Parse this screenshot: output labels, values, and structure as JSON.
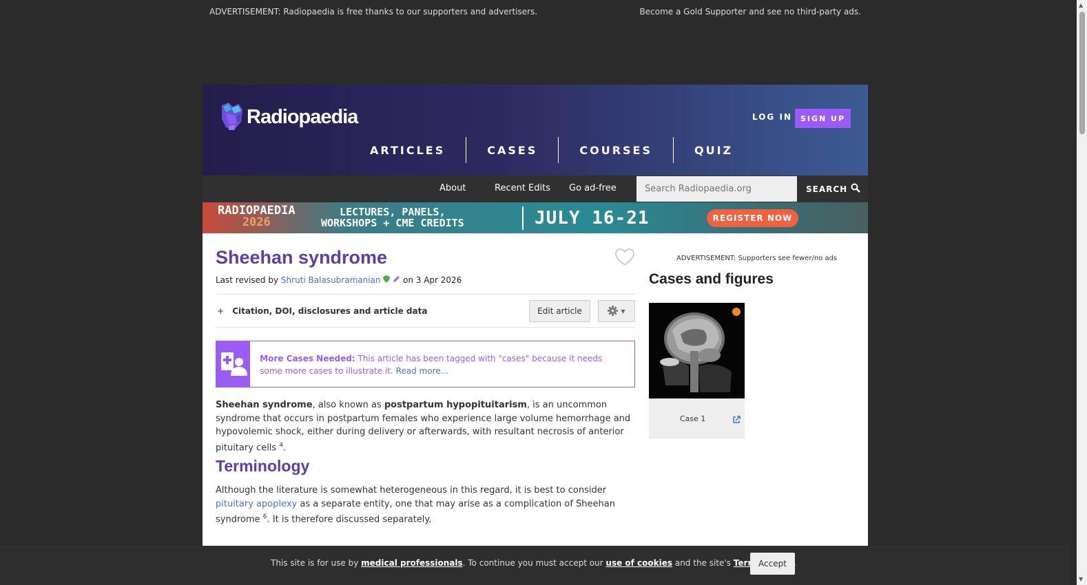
{
  "ad_bar": {
    "left_text": "ADVERTISEMENT: Radiopaedia is free thanks to our supporters and advertisers.",
    "right_text": "Become a Gold Supporter and see no third-party ads."
  },
  "header": {
    "logo_text": "Radiopaedia",
    "login_label": "LOG IN",
    "signup_label": "SIGN UP",
    "nav": [
      "ARTICLES",
      "CASES",
      "COURSES",
      "QUIZ"
    ]
  },
  "subnav": {
    "links": [
      "About",
      "Recent Edits",
      "Go ad-free"
    ],
    "search_placeholder": "Search Radiopaedia.org",
    "search_label": "SEARCH"
  },
  "banner": {
    "line1": "RADIOPAEDIA",
    "line2": "2026",
    "tag1": "LECTURES, PANELS,",
    "tag2": "WORKSHOPS + CME CREDITS",
    "dates": "JULY 16-21",
    "cta": "REGISTER NOW"
  },
  "article": {
    "title": "Sheehan syndrome",
    "revised_prefix": "Last revised by",
    "author": "Shruti Balasubramanian",
    "revised_date": "on 3 Apr 2026",
    "citation_label": "Citation, DOI, disclosures and article data",
    "citation_toggle": "+",
    "edit_label": "Edit article",
    "notice": {
      "heading": "More Cases Needed:",
      "body": "This article has been tagged with \"cases\" because it needs some more cases to illustrate it.",
      "link": "Read more..."
    },
    "intro": {
      "term1": "Sheehan syndrome",
      "part1": ", also known as ",
      "term2": "postpartum hypopituitarism",
      "part2": ", is an uncommon syndrome that occurs in postpartum females who experience large volume hemorrhage and hypovolemic shock, either during delivery or afterwards, with resultant necrosis of anterior pituitary cells ",
      "ref": "4",
      "end": "."
    },
    "section_heading": "Terminology",
    "terminology": {
      "part1": "Although the literature is somewhat heterogeneous in this regard, it is best to consider ",
      "link": "pituitary apoplexy",
      "part2": " as a separate entity, one that may arise as a complication of Sheehan syndrome ",
      "ref": "6",
      "part3": ". It is therefore discussed separately."
    }
  },
  "sidebar": {
    "ad_note": "ADVERTISEMENT: Supporters see fewer/no ads",
    "title": "Cases and figures",
    "case_label": "Case 1"
  },
  "cookie": {
    "text1": "This site is for use by ",
    "link1": "medical professionals",
    "text2": ". To continue you must accept our ",
    "link2": "use of cookies",
    "text3": " and the site's ",
    "link3": "Terms of Use",
    "text4": ".",
    "accept_label": "Accept"
  },
  "colors": {
    "brand_purple": "#5e3ea6",
    "accent_violet": "#9b5cf5",
    "link_blue": "#4a72c0",
    "status_orange": "#f08a24"
  },
  "icons": [
    "logo-mark-icon",
    "heart-icon",
    "pencil-icon",
    "verified-shield-icon",
    "search-icon",
    "gear-icon",
    "caret-down-icon",
    "add-case-icon",
    "external-link-icon"
  ]
}
